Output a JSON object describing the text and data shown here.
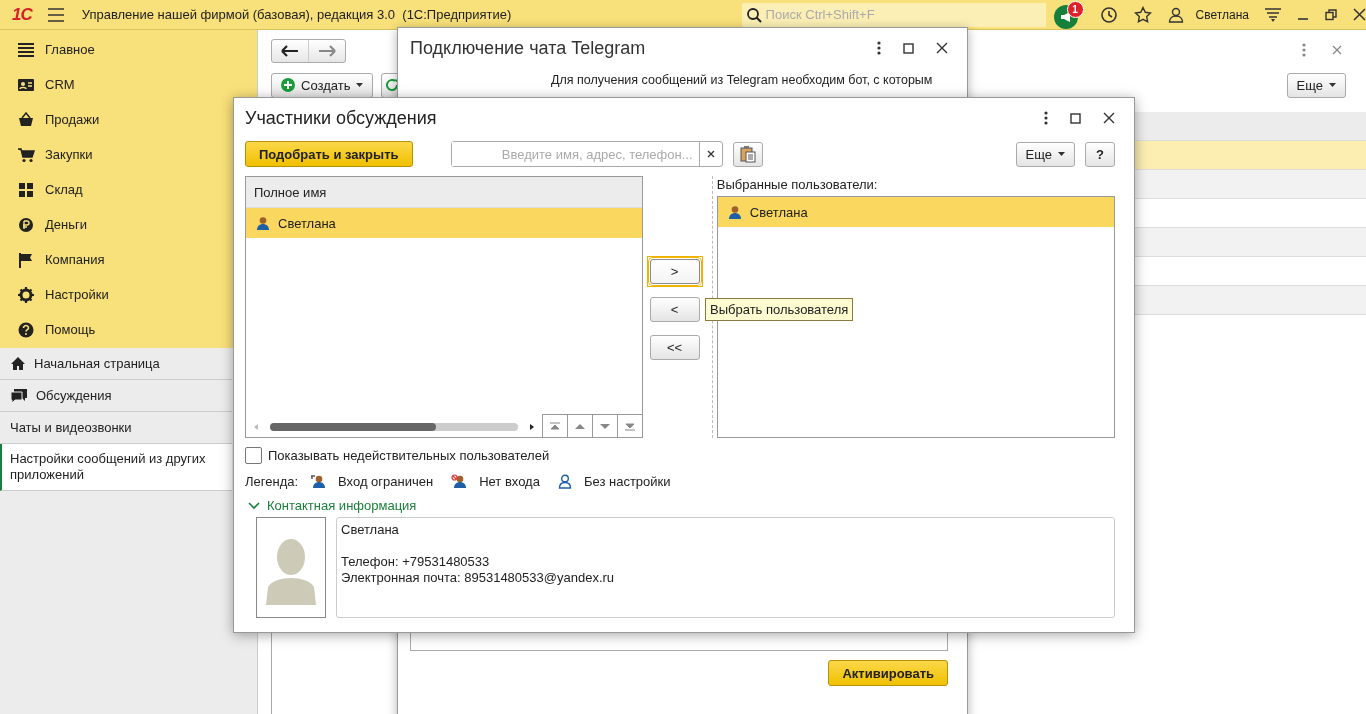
{
  "app_bar": {
    "logo": "1С",
    "title": "Управление нашей фирмой (базовая), редакция 3.0  (1С:Предприятие)",
    "search": {
      "placeholder": "Поиск Ctrl+Shift+F"
    },
    "notification_count": "1",
    "user": "Светлана"
  },
  "sidebar": {
    "sections": [
      {
        "kind": "menu",
        "label": "Главное"
      },
      {
        "kind": "crm",
        "label": "CRM"
      },
      {
        "kind": "sales",
        "label": "Продажи"
      },
      {
        "kind": "purchases",
        "label": "Закупки"
      },
      {
        "kind": "warehouse",
        "label": "Склад"
      },
      {
        "kind": "money",
        "label": "Деньги"
      },
      {
        "kind": "company",
        "label": "Компания"
      },
      {
        "kind": "settings",
        "label": "Настройки"
      },
      {
        "kind": "help",
        "label": "Помощь"
      }
    ],
    "items": [
      {
        "kind": "home",
        "label": "Начальная страница",
        "selected": false
      },
      {
        "kind": "chat",
        "label": "Обсуждения",
        "selected": false
      },
      {
        "kind": "plain",
        "label": "Чаты и видеозвонки",
        "selected": false
      },
      {
        "kind": "plain",
        "label": "Настройки сообщений из других приложений",
        "selected": true
      }
    ]
  },
  "background_form": {
    "create_button": "Создать",
    "more_button": "Еще",
    "rows": [
      {
        "selected": true
      },
      {
        "selected": false
      },
      {
        "selected": false
      },
      {
        "selected": false
      },
      {
        "selected": false
      },
      {
        "selected": false
      }
    ]
  },
  "telegram_window": {
    "title": "Подключение чата Telegram",
    "text_lines": [
      "Для получения сообщений из Telegram необходим бот, с которым"
    ],
    "activate_button": "Активировать"
  },
  "dialog": {
    "title": "Участники обсуждения",
    "pick_button": "Подобрать и закрыть",
    "search": {
      "placeholder": "Введите имя, адрес, телефон..."
    },
    "more_button": "Еще",
    "help_button": "?",
    "users_list": {
      "columns": [
        "Полное имя"
      ],
      "rows": [
        {
          "name": "Светлана",
          "selected": true
        }
      ]
    },
    "move_buttons": [
      {
        "label": ">",
        "focused": true
      },
      {
        "label": "<",
        "focused": false
      },
      {
        "label": "<<",
        "focused": false
      }
    ],
    "tooltip": "Выбрать пользователя",
    "selected_label": "Выбранные пользователи:",
    "selected_users": [
      {
        "name": "Светлана",
        "selected": true
      }
    ],
    "show_invalid": {
      "label": "Показывать недействительных пользователей",
      "checked": false
    },
    "legend": {
      "label": "Легенда:",
      "items": [
        {
          "kind": "restricted",
          "label": "Вход ограничен"
        },
        {
          "kind": "no_login",
          "label": "Нет входа"
        },
        {
          "kind": "not_set",
          "label": "Без настройки"
        }
      ]
    },
    "contact_info": {
      "title": "Контактная информация",
      "expanded": true,
      "name": "Светлана",
      "details": [
        "Телефон: +79531480533",
        "Электронная почта: 89531480533@yandex.ru"
      ]
    }
  }
}
